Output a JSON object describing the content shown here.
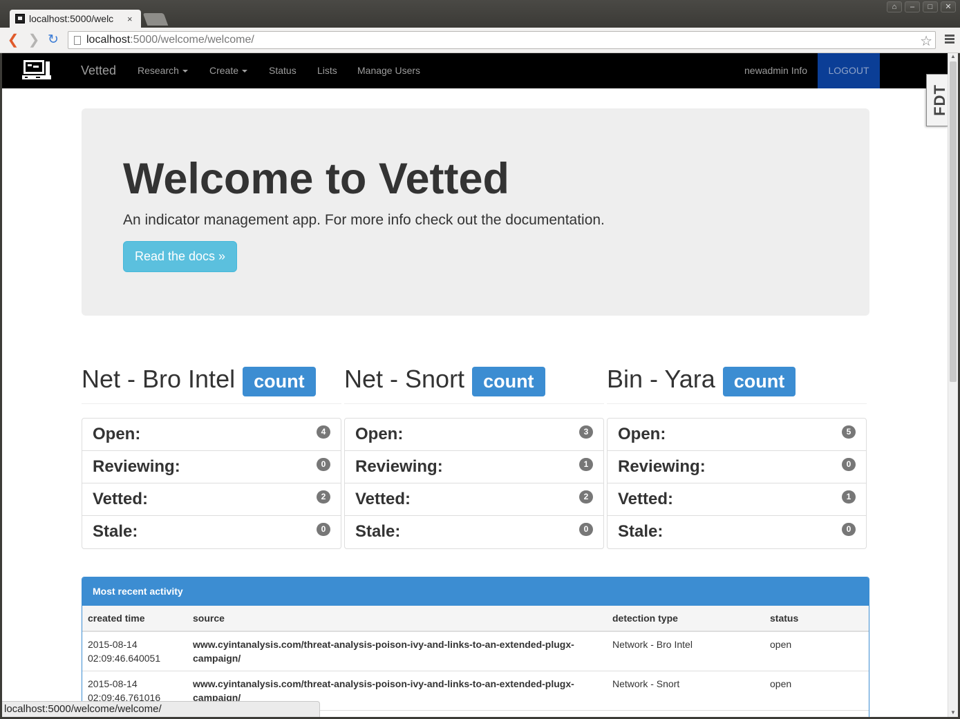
{
  "browser": {
    "tab_title": "localhost:5000/welc",
    "tab_close": "×",
    "url_host": "localhost",
    "url_path": ":5000/welcome/welcome/",
    "window_controls": [
      "⌂",
      "–",
      "□",
      "✕"
    ],
    "status_url": "localhost:5000/welcome/welcome/"
  },
  "navbar": {
    "brand": "Vetted",
    "items": [
      {
        "label": "Research",
        "dropdown": true
      },
      {
        "label": "Create",
        "dropdown": true
      },
      {
        "label": "Status",
        "dropdown": false
      },
      {
        "label": "Lists",
        "dropdown": false
      },
      {
        "label": "Manage Users",
        "dropdown": false
      }
    ],
    "user": "newadmin Info",
    "logout": "LOGOUT"
  },
  "fdt_tab": "FDT",
  "jumbotron": {
    "title": "Welcome to Vetted",
    "lead": "An indicator management app. For more info check out the documentation.",
    "button": "Read the docs »"
  },
  "stats": [
    {
      "title": "Net - Bro Intel",
      "badge": "count",
      "items": [
        {
          "label": "Open:",
          "value": "4"
        },
        {
          "label": "Reviewing:",
          "value": "0"
        },
        {
          "label": "Vetted:",
          "value": "2"
        },
        {
          "label": "Stale:",
          "value": "0"
        }
      ]
    },
    {
      "title": "Net - Snort",
      "badge": "count",
      "items": [
        {
          "label": "Open:",
          "value": "3"
        },
        {
          "label": "Reviewing:",
          "value": "1"
        },
        {
          "label": "Vetted:",
          "value": "2"
        },
        {
          "label": "Stale:",
          "value": "0"
        }
      ]
    },
    {
      "title": "Bin - Yara",
      "badge": "count",
      "items": [
        {
          "label": "Open:",
          "value": "5"
        },
        {
          "label": "Reviewing:",
          "value": "0"
        },
        {
          "label": "Vetted:",
          "value": "1"
        },
        {
          "label": "Stale:",
          "value": "0"
        }
      ]
    }
  ],
  "activity": {
    "heading": "Most recent activity",
    "columns": [
      "created time",
      "source",
      "detection type",
      "status"
    ],
    "rows": [
      {
        "created": "2015-08-14 02:09:46.640051",
        "source": "www.cyintanalysis.com/threat-analysis-poison-ivy-and-links-to-an-extended-plugx-campaign/",
        "type": "Network - Bro Intel",
        "status": "open"
      },
      {
        "created": "2015-08-14 02:09:46.761016",
        "source": "www.cyintanalysis.com/threat-analysis-poison-ivy-and-links-to-an-extended-plugx-campaign/",
        "type": "Network - Snort",
        "status": "open"
      }
    ]
  },
  "colors": {
    "navbar": "#000000",
    "logout_bg": "#0b3e96",
    "primary": "#3c8dd2",
    "info_button": "#5bc0de",
    "jumbotron": "#eeeeee",
    "badge": "#777777"
  }
}
